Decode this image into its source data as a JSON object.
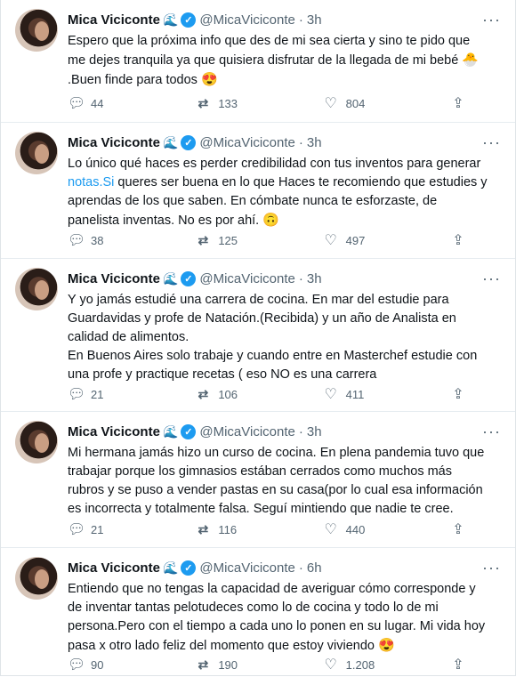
{
  "tweets": [
    {
      "name": "Mica Viciconte",
      "handle": "@MicaViciconte",
      "time": "3h",
      "text_parts": [
        "Espero que la próxima info que des de mi sea cierta y sino te pido que me dejes tranquila ya que quisiera disfrutar de la llegada de mi bebé ",
        " .Buen finde para todos "
      ],
      "emojis": [
        "🐣",
        "😍"
      ],
      "replies": "44",
      "retweets": "133",
      "likes": "804"
    },
    {
      "name": "Mica Viciconte",
      "handle": "@MicaViciconte",
      "time": "3h",
      "text_before_link": "Lo único qué haces es perder credibilidad con tus inventos para generar ",
      "link_text": "notas.Si",
      "text_after_link": " queres ser buena en lo que Haces te recomiendo que estudies y aprendas de los que saben. En cómbate nunca te esforzaste, de panelista inventas. No es por ahí. ",
      "emoji": "🙃",
      "replies": "38",
      "retweets": "125",
      "likes": "497"
    },
    {
      "name": "Mica Viciconte",
      "handle": "@MicaViciconte",
      "time": "3h",
      "text_p1": "Y yo jamás estudié una carrera de cocina. En mar del estudie para Guardavidas y profe de Natación.(Recibida) y un año de Analista en calidad de alimentos.",
      "text_p2": "En Buenos Aires solo trabaje y cuando entre en Masterchef estudie con una profe  y practique recetas ( eso NO es una carrera",
      "replies": "21",
      "retweets": "106",
      "likes": "411"
    },
    {
      "name": "Mica Viciconte",
      "handle": "@MicaViciconte",
      "time": "3h",
      "text": "Mi hermana jamás hizo un curso de cocina. En plena pandemia tuvo que trabajar porque los gimnasios estában cerrados como muchos más rubros y se puso a vender pastas en su casa(por lo cual esa información es incorrecta y totalmente falsa. Seguí mintiendo que nadie te cree.",
      "replies": "21",
      "retweets": "116",
      "likes": "440"
    },
    {
      "name": "Mica Viciconte",
      "handle": "@MicaViciconte",
      "time": "6h",
      "text": "Entiendo que no tengas la capacidad de averiguar cómo corresponde y de inventar tantas pelotudeces como lo de cocina y todo lo de mi persona.Pero con el tiempo a cada uno lo ponen en su lugar. Mi vida hoy pasa x otro lado feliz del momento que estoy viviendo ",
      "emoji": "😍",
      "replies": "90",
      "retweets": "190",
      "likes": "1.208"
    }
  ],
  "icons": {
    "more": "more-dots-icon",
    "reply": "reply-icon",
    "retweet": "retweet-icon",
    "like": "heart-icon",
    "share": "share-icon",
    "verified": "verified-badge-icon",
    "wave": "wave-icon"
  },
  "colors": {
    "accent": "#1d9bf0",
    "muted": "#536471",
    "text": "#0f1419"
  }
}
